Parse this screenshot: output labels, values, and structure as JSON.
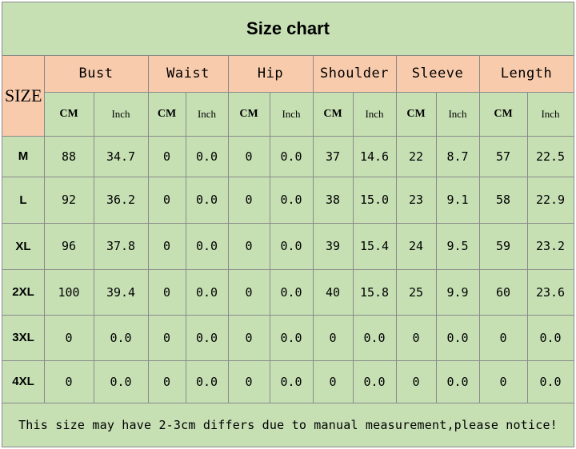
{
  "title": "Size chart",
  "size_header": "SIZE",
  "groups": [
    {
      "label": "Bust",
      "units": [
        "CM",
        "Inch"
      ]
    },
    {
      "label": "Waist",
      "units": [
        "CM",
        "Inch"
      ]
    },
    {
      "label": "Hip",
      "units": [
        "CM",
        "Inch"
      ]
    },
    {
      "label": "Shoulder",
      "units": [
        "CM",
        "Inch"
      ]
    },
    {
      "label": "Sleeve",
      "units": [
        "CM",
        "Inch"
      ]
    },
    {
      "label": "Length",
      "units": [
        "CM",
        "Inch"
      ]
    }
  ],
  "rows": [
    {
      "size": "M",
      "values": [
        "88",
        "34.7",
        "0",
        "0.0",
        "0",
        "0.0",
        "37",
        "14.6",
        "22",
        "8.7",
        "57",
        "22.5"
      ]
    },
    {
      "size": "L",
      "values": [
        "92",
        "36.2",
        "0",
        "0.0",
        "0",
        "0.0",
        "38",
        "15.0",
        "23",
        "9.1",
        "58",
        "22.9"
      ]
    },
    {
      "size": "XL",
      "values": [
        "96",
        "37.8",
        "0",
        "0.0",
        "0",
        "0.0",
        "39",
        "15.4",
        "24",
        "9.5",
        "59",
        "23.2"
      ]
    },
    {
      "size": "2XL",
      "values": [
        "100",
        "39.4",
        "0",
        "0.0",
        "0",
        "0.0",
        "40",
        "15.8",
        "25",
        "9.9",
        "60",
        "23.6"
      ]
    },
    {
      "size": "3XL",
      "values": [
        "0",
        "0.0",
        "0",
        "0.0",
        "0",
        "0.0",
        "0",
        "0.0",
        "0",
        "0.0",
        "0",
        "0.0"
      ]
    },
    {
      "size": "4XL",
      "values": [
        "0",
        "0.0",
        "0",
        "0.0",
        "0",
        "0.0",
        "0",
        "0.0",
        "0",
        "0.0",
        "0",
        "0.0"
      ]
    }
  ],
  "note": "This size may have 2-3cm differs due to manual measurement,please notice!",
  "colors": {
    "body": "#c6e0b4",
    "header": "#f8cbad",
    "grid": "#8a8a8a"
  }
}
